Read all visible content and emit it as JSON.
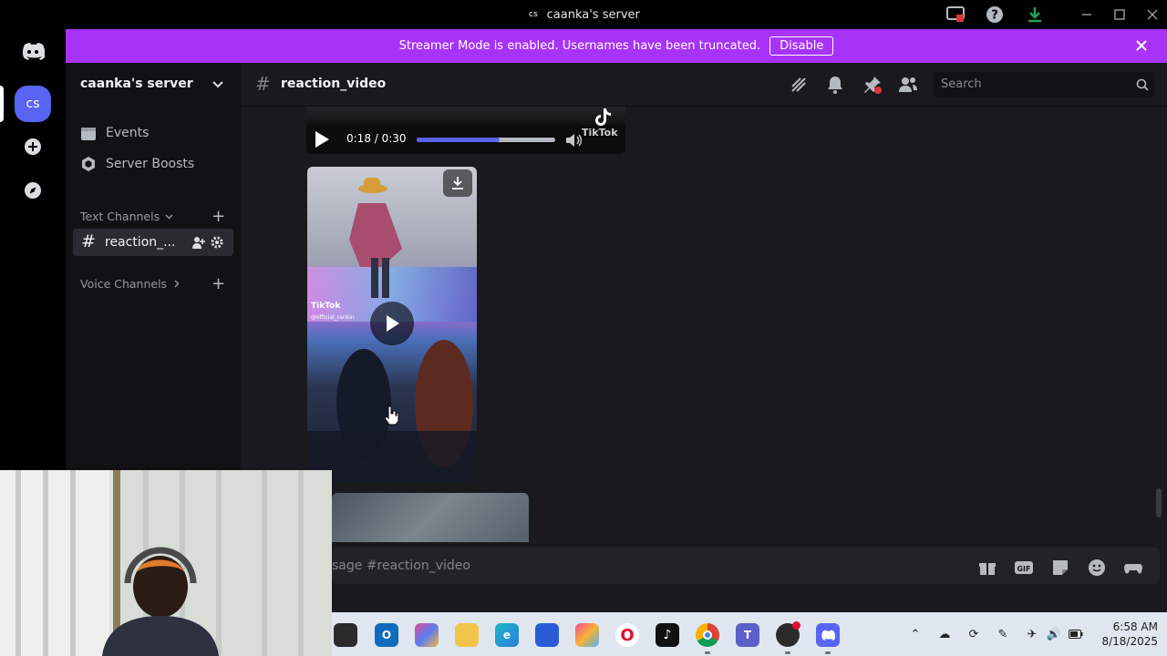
{
  "window": {
    "title": "caanka's server",
    "title_badge": "cs"
  },
  "banner": {
    "text": "Streamer Mode is enabled. Usernames have been truncated.",
    "button": "Disable"
  },
  "rail": {
    "server_initials": "cs"
  },
  "sidebar": {
    "server_name": "caanka's server",
    "menu": [
      {
        "label": "Events",
        "icon": "calendar-icon"
      },
      {
        "label": "Server Boosts",
        "icon": "boost-icon"
      }
    ],
    "categories": {
      "text": "Text Channels",
      "voice": "Voice Channels"
    },
    "active_channel": "reaction_..."
  },
  "chat": {
    "channel_name": "reaction_video",
    "search_placeholder": "Search",
    "audio_player": {
      "time": "0:18 / 0:30",
      "progress": 0.6,
      "watermark": "TikTok"
    },
    "video_card": {
      "watermark": "TikTok",
      "handle": "@official_rankin"
    },
    "composer_placeholder": "sage #reaction_video"
  },
  "taskbar": {
    "time": "6:58 AM",
    "date": "8/18/2025"
  },
  "colors": {
    "banner": "#a733f6",
    "accent": "#5865f2",
    "progress": "#5865f2"
  }
}
